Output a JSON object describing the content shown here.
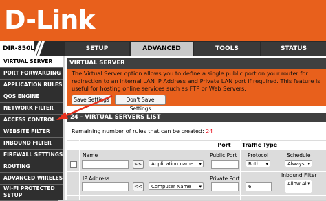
{
  "brand": {
    "logo": "D-Link",
    "model": "DIR-850L"
  },
  "tabs": [
    {
      "label": "SETUP"
    },
    {
      "label": "ADVANCED"
    },
    {
      "label": "TOOLS"
    },
    {
      "label": "STATUS"
    }
  ],
  "active_tab": "ADVANCED",
  "sidebar": {
    "items": [
      {
        "label": "VIRTUAL SERVER"
      },
      {
        "label": "PORT FORWARDING"
      },
      {
        "label": "APPLICATION RULES"
      },
      {
        "label": "QOS ENGINE"
      },
      {
        "label": "NETWORK FILTER"
      },
      {
        "label": "ACCESS CONTROL"
      },
      {
        "label": "WEBSITE FILTER"
      },
      {
        "label": "INBOUND FILTER"
      },
      {
        "label": "FIREWALL SETTINGS"
      },
      {
        "label": "ROUTING"
      },
      {
        "label": "ADVANCED WIRELESS"
      },
      {
        "label": "WI-FI PROTECTED SETUP"
      }
    ]
  },
  "virtual_server": {
    "title": "VIRTUAL SERVER",
    "description": "The Virtual Server option allows you to define a single public port on your router for redirection to an internal LAN IP Address and Private LAN port if required. This feature is useful for hosting online services such as FTP or Web Servers.",
    "save_label": "Save Settings",
    "dont_save_label": "Don't Save Settings"
  },
  "list": {
    "title": "24 - VIRTUAL SERVERS LIST",
    "remaining_label": "Remaining number of rules that can be created:",
    "remaining_count": "24",
    "headers": {
      "port": "Port",
      "traffic_type": "Traffic Type"
    },
    "row1": {
      "name_label": "Name",
      "arrow_label": "<<",
      "app_select": "Application name",
      "public_port_label": "Public Port",
      "protocol_label": "Protocol",
      "protocol_value": "Both",
      "schedule_label": "Schedule",
      "schedule_value": "Always"
    },
    "row2": {
      "ip_label": "IP Address",
      "arrow_label": "<<",
      "computer_select": "Computer Name",
      "private_port_label": "Private Port",
      "protocol_value": "6",
      "inbound_label": "Inbound Filter",
      "inbound_value": "Allow Al"
    }
  },
  "colors": {
    "accent": "#e8601c",
    "dark": "#2f2f2f",
    "annotation": "#e8301c"
  }
}
